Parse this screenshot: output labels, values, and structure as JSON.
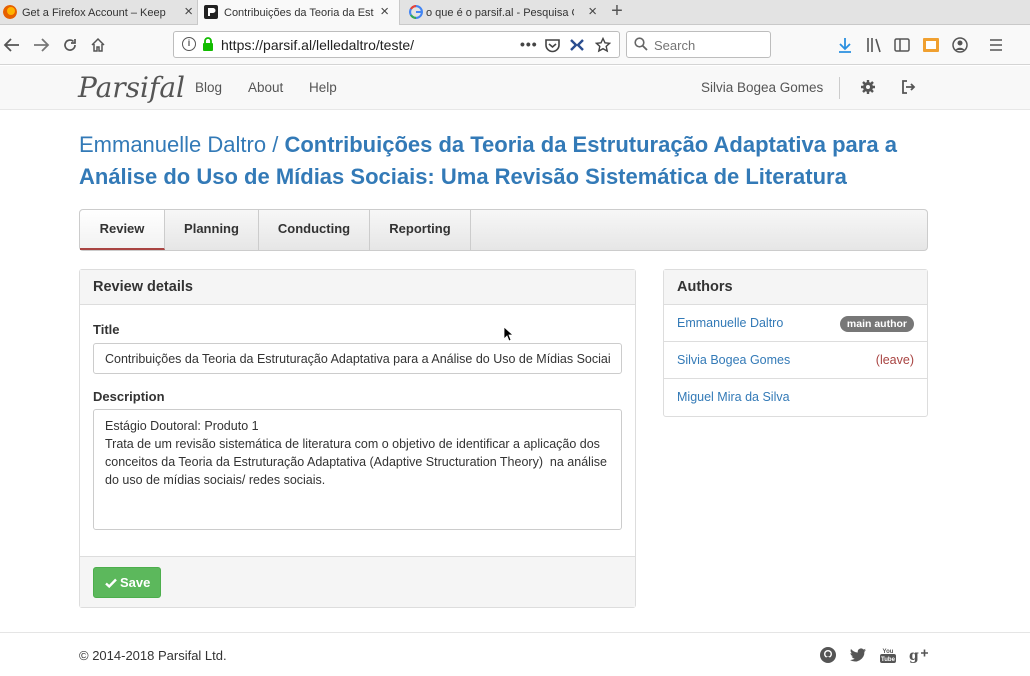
{
  "browser": {
    "tabs": [
      {
        "title": "Get a Firefox Account – Keep yo",
        "favicon": "firefox-icon",
        "active": false
      },
      {
        "title": "Contribuições da Teoria da Estr",
        "favicon": "parsifal-icon",
        "active": true
      },
      {
        "title": "o que é o parsif.al - Pesquisa G",
        "favicon": "google-icon",
        "active": false
      }
    ],
    "url_prefix": "https://",
    "url_host": "parsif.al",
    "url_path": "/lelledaltro/teste/",
    "search_placeholder": "Search"
  },
  "site": {
    "brand": "Parsifal",
    "menu": [
      "Blog",
      "About",
      "Help"
    ],
    "user": "Silvia Bogea Gomes"
  },
  "review": {
    "owner": "Emmanuelle Daltro",
    "separator": "/",
    "title": "Contribuições da Teoria da Estruturação Adaptativa para a Análise do Uso de Mídias Sociais: Uma Revisão Sistemática de Literatura",
    "tabs": [
      "Review",
      "Planning",
      "Conducting",
      "Reporting"
    ],
    "active_tab": "Review"
  },
  "details": {
    "heading": "Review details",
    "title_label": "Title",
    "title_value": "Contribuições da Teoria da Estruturação Adaptativa para a Análise do Uso de Mídias Sociais: Uma Revisão Sistemática de Literatura",
    "description_label": "Description",
    "description_value": "Estágio Doutoral: Produto 1\nTrata de um revisão sistemática de literatura com o objetivo de identificar a aplicação dos conceitos da Teoria da Estruturação Adaptativa (Adaptive Structuration Theory)  na análise do uso de mídias sociais/ redes sociais.",
    "save_label": "Save"
  },
  "authors": {
    "heading": "Authors",
    "list": [
      {
        "name": "Emmanuelle Daltro",
        "tag": "main author"
      },
      {
        "name": "Silvia Bogea Gomes",
        "tag": "(leave)"
      },
      {
        "name": "Miguel Mira da Silva",
        "tag": ""
      }
    ]
  },
  "footer": {
    "copyright": "© 2014-2018 Parsifal Ltd.",
    "social": [
      "github-icon",
      "twitter-icon",
      "youtube-icon",
      "google-plus-icon"
    ]
  },
  "colors": {
    "link": "#337ab7",
    "save": "#5cb85c",
    "leave": "#a94442",
    "active_tab_border": "#a94442"
  }
}
